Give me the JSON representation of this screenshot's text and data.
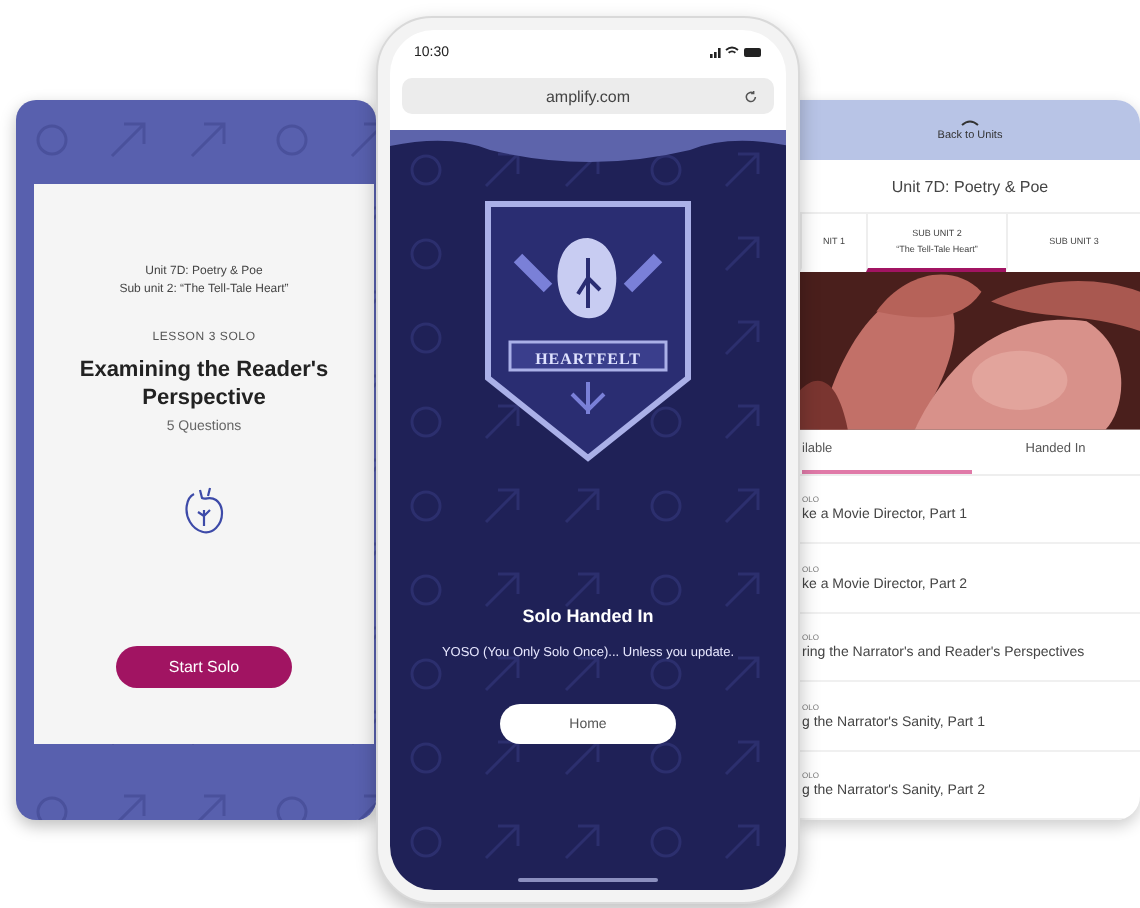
{
  "left_card": {
    "unit": "Unit 7D: Poetry & Poe",
    "subunit": "Sub unit 2: “The Tell-Tale Heart”",
    "lesson": "LESSON 3 SOLO",
    "title": "Examining the Reader's Perspective",
    "questions": "5 Questions",
    "button": "Start Solo"
  },
  "phone": {
    "time": "10:30",
    "url": "amplify.com",
    "badge_label": "HEARTFELT",
    "heading": "Solo Handed In",
    "message": "YOSO (You Only Solo Once)... Unless you update.",
    "button": "Home"
  },
  "right_card": {
    "back": "Back to Units",
    "title": "Unit 7D: Poetry & Poe",
    "subunits": [
      {
        "label": "NIT 1",
        "selected": false
      },
      {
        "label": "SUB UNIT 2",
        "name": "“The Tell-Tale Heart”",
        "selected": true
      },
      {
        "label": "SUB UNIT 3",
        "selected": false
      }
    ],
    "tabs": [
      {
        "label": "ilable",
        "selected": true
      },
      {
        "label": "Handed In",
        "selected": false
      }
    ],
    "lessons": [
      {
        "type": "OLO",
        "title": "ke a Movie Director, Part 1"
      },
      {
        "type": "OLO",
        "title": "ke a Movie Director, Part 2"
      },
      {
        "type": "OLO",
        "title": "ring the Narrator's and Reader's Perspectives"
      },
      {
        "type": "OLO",
        "title": "g the Narrator's Sanity, Part 1"
      },
      {
        "type": "OLO",
        "title": "g the Narrator's Sanity, Part 2"
      }
    ]
  }
}
